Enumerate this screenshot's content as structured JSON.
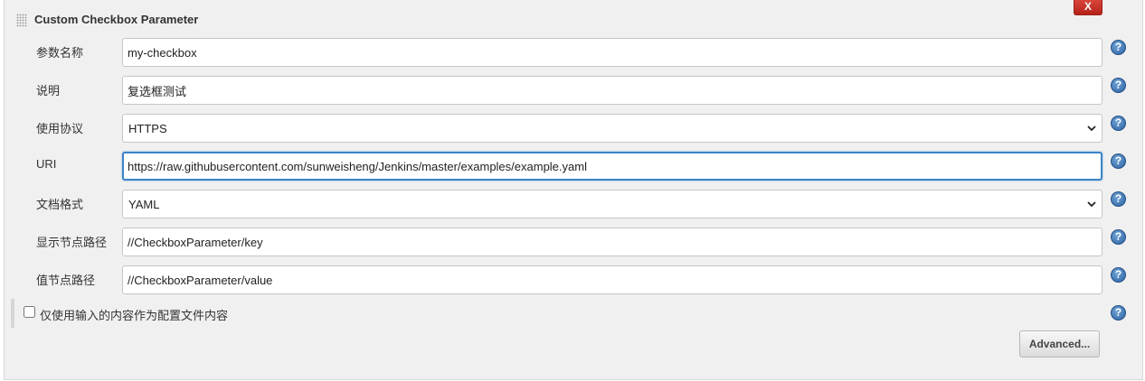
{
  "section": {
    "title": "Custom Checkbox Parameter",
    "close_label": "X"
  },
  "fields": [
    {
      "label": "参数名称",
      "type": "text",
      "value": "my-checkbox"
    },
    {
      "label": "说明",
      "type": "text",
      "value": "复选框测试"
    },
    {
      "label": "使用协议",
      "type": "select",
      "value": "HTTPS"
    },
    {
      "label": "URI",
      "type": "text",
      "value": "https://raw.githubusercontent.com/sunweisheng/Jenkins/master/examples/example.yaml",
      "focused": true
    },
    {
      "label": "文档格式",
      "type": "select",
      "value": "YAML"
    },
    {
      "label": "显示节点路径",
      "type": "text",
      "value": "//CheckboxParameter/key"
    },
    {
      "label": "值节点路径",
      "type": "text",
      "value": "//CheckboxParameter/value"
    }
  ],
  "checkbox": {
    "label": "仅使用输入的内容作为配置文件内容",
    "checked": false
  },
  "help_icon": "?",
  "advanced_label": "Advanced...",
  "colors": {
    "close_button": "#c7362c",
    "help_icon": "#2c63a3",
    "focus_border": "#3d84c6",
    "panel_bg": "#f0f0f0"
  }
}
